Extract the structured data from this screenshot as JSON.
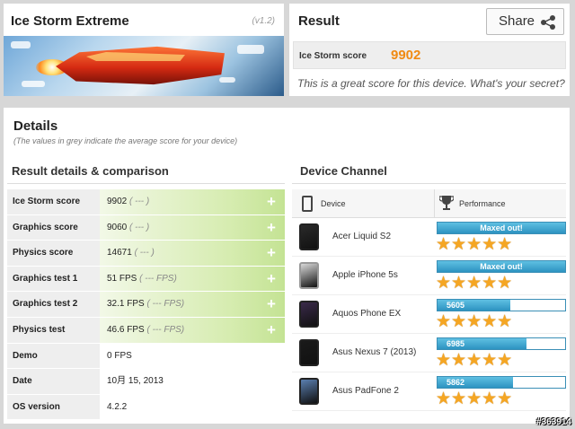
{
  "app": {
    "title": "Ice Storm Extreme",
    "version": "(v1.2)"
  },
  "result": {
    "title": "Result",
    "share_label": "Share",
    "score_label": "Ice Storm score",
    "score_value": "9902",
    "message": "This is a great score for this device. What's your secret?"
  },
  "details": {
    "title": "Details",
    "subtitle": "(The values in grey indicate the average score for your device)",
    "left_section_title": "Result details & comparison",
    "right_section_title": "Device Channel",
    "rows": [
      {
        "label": "Ice Storm score",
        "value": "9902",
        "avg": "( --- )",
        "expandable": true
      },
      {
        "label": "Graphics score",
        "value": "9060",
        "avg": "( --- )",
        "expandable": true
      },
      {
        "label": "Physics score",
        "value": "14671",
        "avg": "( --- )",
        "expandable": true
      },
      {
        "label": "Graphics test 1",
        "value": "51 FPS",
        "avg": "( --- FPS)",
        "expandable": true
      },
      {
        "label": "Graphics test 2",
        "value": "32.1 FPS",
        "avg": "( --- FPS)",
        "expandable": true
      },
      {
        "label": "Physics test",
        "value": "46.6 FPS",
        "avg": "( --- FPS)",
        "expandable": true
      },
      {
        "label": "Demo",
        "value": "0 FPS",
        "avg": "",
        "expandable": false
      },
      {
        "label": "Date",
        "value": "10月 15, 2013",
        "avg": "",
        "expandable": false
      },
      {
        "label": "OS version",
        "value": "4.2.2",
        "avg": "",
        "expandable": false
      }
    ],
    "device_header": {
      "device": "Device",
      "performance": "Performance"
    },
    "devices": [
      {
        "name": "Acer Liquid S2",
        "perf_text": "Maxed out!",
        "fill": 1.0,
        "stars": 5,
        "phone_color": "#2a2a2a"
      },
      {
        "name": "Apple iPhone 5s",
        "perf_text": "Maxed out!",
        "fill": 1.0,
        "stars": 5,
        "phone_color": "#d8d8d8"
      },
      {
        "name": "Aquos Phone EX",
        "perf_text": "5605",
        "fill": 0.57,
        "stars": 5,
        "phone_color": "#3a2a4a"
      },
      {
        "name": "Asus Nexus 7 (2013)",
        "perf_text": "6985",
        "fill": 0.7,
        "stars": 5,
        "phone_color": "#1a1a1a"
      },
      {
        "name": "Asus PadFone 2",
        "perf_text": "5862",
        "fill": 0.59,
        "stars": 5,
        "phone_color": "#5a7fb0"
      }
    ]
  },
  "watermark": "#363914",
  "colors": {
    "accent_orange": "#f08a12",
    "perf_blue": "#2d93c1",
    "star": "#f5a623",
    "compare_green": "#c4e394"
  }
}
